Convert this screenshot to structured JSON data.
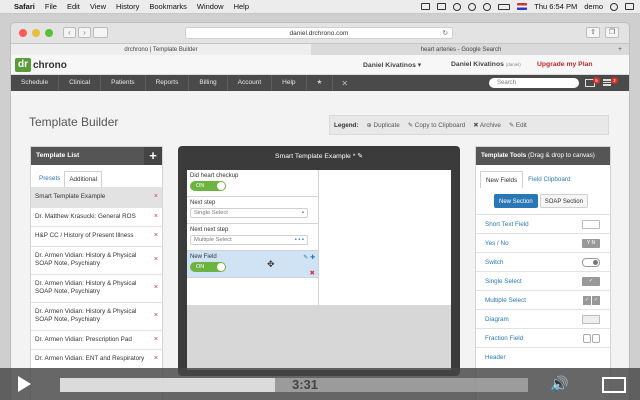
{
  "menubar": {
    "apple": "",
    "app": "Safari",
    "items": [
      "File",
      "Edit",
      "View",
      "History",
      "Bookmarks",
      "Window",
      "Help"
    ],
    "clock": "Thu 6:54 PM",
    "user": "demo"
  },
  "browser": {
    "url": "daniel.drchrono.com",
    "tabs": [
      "drchrono | Template Builder",
      "heart arteries - Google Search",
      "+"
    ]
  },
  "topbar": {
    "logo_dr": "dr",
    "logo_chrono": "chrono",
    "user1": "Daniel Kivatinos ▾",
    "user2": "Daniel Kivatinos",
    "user2_note": "(daniel)",
    "upgrade": "Upgrade my Plan"
  },
  "nav": {
    "items": [
      "Schedule",
      "Clinical",
      "Patients",
      "Reports",
      "Billing",
      "Account",
      "Help"
    ],
    "search_placeholder": "Search",
    "mail_badge": "5",
    "menu_badge": "2"
  },
  "page": {
    "title": "Template Builder"
  },
  "legend": {
    "label": "Legend:",
    "duplicate": "⊕ Duplicate",
    "copy": "✎ Copy to Clipboard",
    "archive": "✖ Archive",
    "edit": "✎ Edit"
  },
  "template_list": {
    "title": "Template List",
    "plus": "+",
    "tabs": [
      "Presets",
      "Additional"
    ],
    "items": [
      "Smart Template Example",
      "Dr. Matthew Krasucki: General ROS",
      "H&P CC / History of Present Illness",
      "Dr. Armen Vidian: History & Physical SOAP Note, Psychiatry",
      "Dr. Armen Vidian: History & Physical SOAP Note, Psychiatry",
      "Dr. Armen Vidian: History & Physical SOAP Note, Psychiatry",
      "Dr. Armen Vidian: Prescription Pad",
      "Dr. Armen Vidian: ENT and Respiratory"
    ],
    "delete_glyph": "×"
  },
  "canvas": {
    "title": "Smart Template Example *",
    "fields": [
      {
        "label": "Did heart checkup",
        "kind": "toggle",
        "value": "ON"
      },
      {
        "label": "Next step",
        "kind": "select",
        "value": "Single Select"
      },
      {
        "label": "Next next step",
        "kind": "select",
        "value": "Multiple Select"
      },
      {
        "label": "New Field",
        "kind": "toggle",
        "value": "ON"
      }
    ],
    "single_dots": "•",
    "multi_dots": "• • •"
  },
  "tools": {
    "title": "Template Tools",
    "subtitle": "(Drag & drop to canvas)",
    "tabs": [
      "New Fields",
      "Field Clipboard"
    ],
    "section_buttons": [
      "New Section",
      "SOAP Section"
    ],
    "items": [
      "Short Text Field",
      "Yes / No",
      "Switch",
      "Single Select",
      "Multiple Select",
      "Diagram",
      "Fraction Field",
      "Header"
    ],
    "yn_icon": "Y N"
  },
  "video": {
    "time": "3:31",
    "progress": 0.46
  }
}
